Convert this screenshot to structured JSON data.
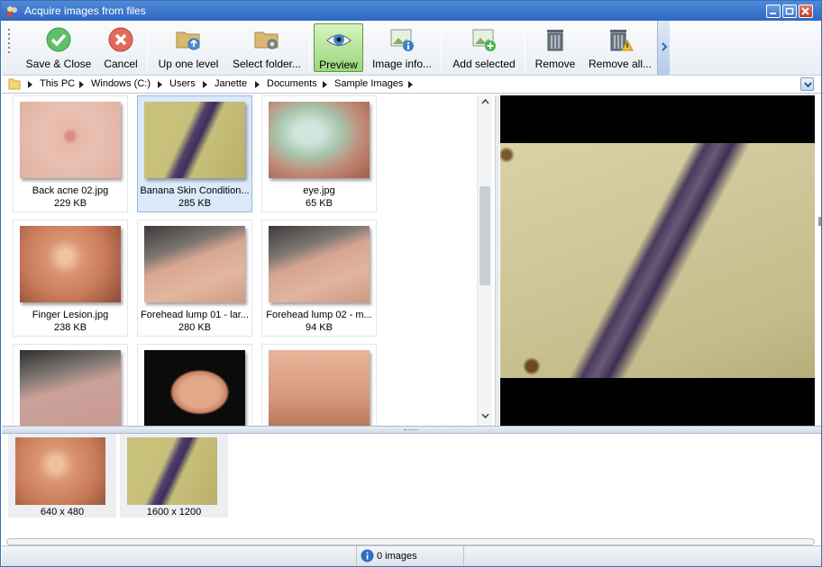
{
  "window": {
    "title": "Acquire images from files"
  },
  "toolbar": {
    "buttons": [
      {
        "label": "Save & Close",
        "icon": "check-icon"
      },
      {
        "label": "Cancel",
        "icon": "cancel-icon"
      },
      {
        "label": "Up one level",
        "icon": "folder-up-icon"
      },
      {
        "label": "Select folder...",
        "icon": "folder-gear-icon"
      },
      {
        "label": "Preview",
        "icon": "eye-icon",
        "active": true
      },
      {
        "label": "Image info...",
        "icon": "image-info-icon"
      },
      {
        "label": "Add selected",
        "icon": "image-add-icon"
      },
      {
        "label": "Remove",
        "icon": "trash-icon"
      },
      {
        "label": "Remove all...",
        "icon": "trash-warning-icon"
      }
    ]
  },
  "breadcrumb": [
    "This PC",
    "Windows (C:)",
    "Users",
    "Janette",
    "Documents",
    "Sample Images"
  ],
  "grid": {
    "items": [
      {
        "name": "Back acne 02.jpg",
        "size": "229 KB"
      },
      {
        "name": "Banana Skin Condition...",
        "size": "285 KB",
        "selected": true
      },
      {
        "name": "eye.jpg",
        "size": "65 KB"
      },
      {
        "name": "Finger Lesion.jpg",
        "size": "238 KB"
      },
      {
        "name": "Forehead lump 01 - lar...",
        "size": "280 KB"
      },
      {
        "name": "Forehead lump 02 - m...",
        "size": "94 KB"
      },
      {
        "name": "",
        "size": ""
      },
      {
        "name": "",
        "size": ""
      },
      {
        "name": "",
        "size": ""
      }
    ]
  },
  "selected_strip": [
    {
      "dimensions": "640 x 480"
    },
    {
      "dimensions": "1600 x 1200"
    }
  ],
  "status": {
    "text": "0 images"
  },
  "colors": {
    "titlebar": "#2d67c2",
    "active_button": "#9ad77a",
    "selection": "#dbe9f8"
  }
}
